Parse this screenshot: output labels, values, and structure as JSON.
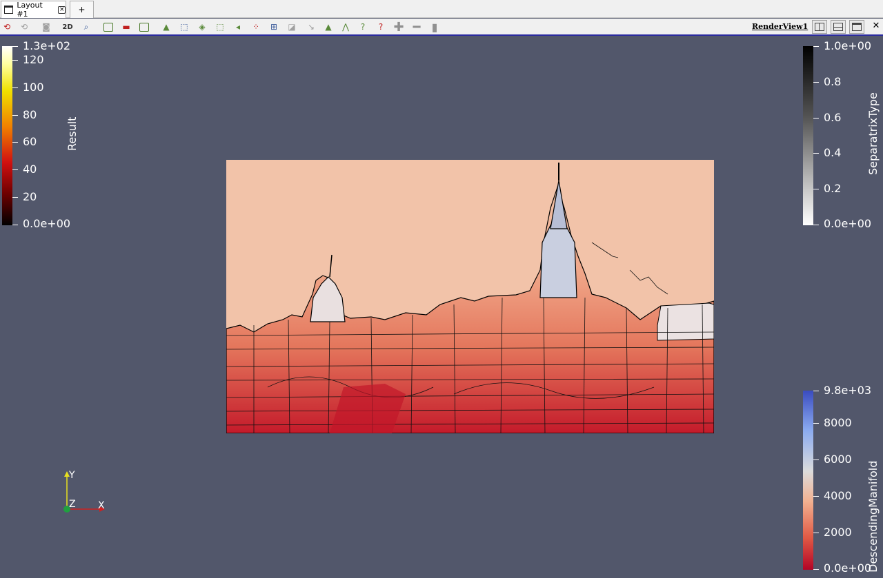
{
  "tabs": {
    "layout_label": "Layout #1",
    "close_glyph": "×",
    "add_label": "+"
  },
  "toolbar": {
    "icons": [
      "reset-camera-icon",
      "reset-camera-closest-icon",
      "capture-screenshot-icon",
      "toggle-2d-icon",
      "zoom-to-box-icon",
      "select-cells-on-icon",
      "select-points-on-icon",
      "select-points-frustum-icon",
      "select-cells-through-icon",
      "select-points-through-icon",
      "select-cells-polygon-icon",
      "select-points-polygon-icon",
      "select-block-icon",
      "interactive-select-cells-icon",
      "interactive-select-points-icon",
      "hover-points-icon",
      "hover-cells-icon",
      "grow-selection-icon",
      "shrink-selection-icon",
      "clear-selection-icon",
      "add-selection-icon",
      "subtract-selection-icon",
      "delete-icon"
    ],
    "twod_label": "2D",
    "renderview_label": "RenderView1",
    "close_glyph": "✕"
  },
  "colorbars": {
    "result": {
      "title": "Result",
      "labels": [
        "1.3e+02",
        "120",
        "100",
        "80",
        "60",
        "40",
        "20",
        "0.0e+00"
      ]
    },
    "separatrix": {
      "title": "SeparatrixType",
      "labels": [
        "1.0e+00",
        "0.8",
        "0.6",
        "0.4",
        "0.2",
        "0.0e+00"
      ]
    },
    "descending": {
      "title": "DescendingManifold",
      "labels": [
        "9.8e+03",
        "8000",
        "6000",
        "4000",
        "2000",
        "0.0e+00"
      ]
    }
  },
  "axes": {
    "x": "X",
    "y": "Y",
    "z": "Z"
  },
  "colors": {
    "background": "#52576b",
    "image_sky": "#f2c3a9",
    "image_low": "#c41a2a",
    "x_axis": "#d02020",
    "y_axis": "#e8e020",
    "z_axis": "#20a040"
  }
}
